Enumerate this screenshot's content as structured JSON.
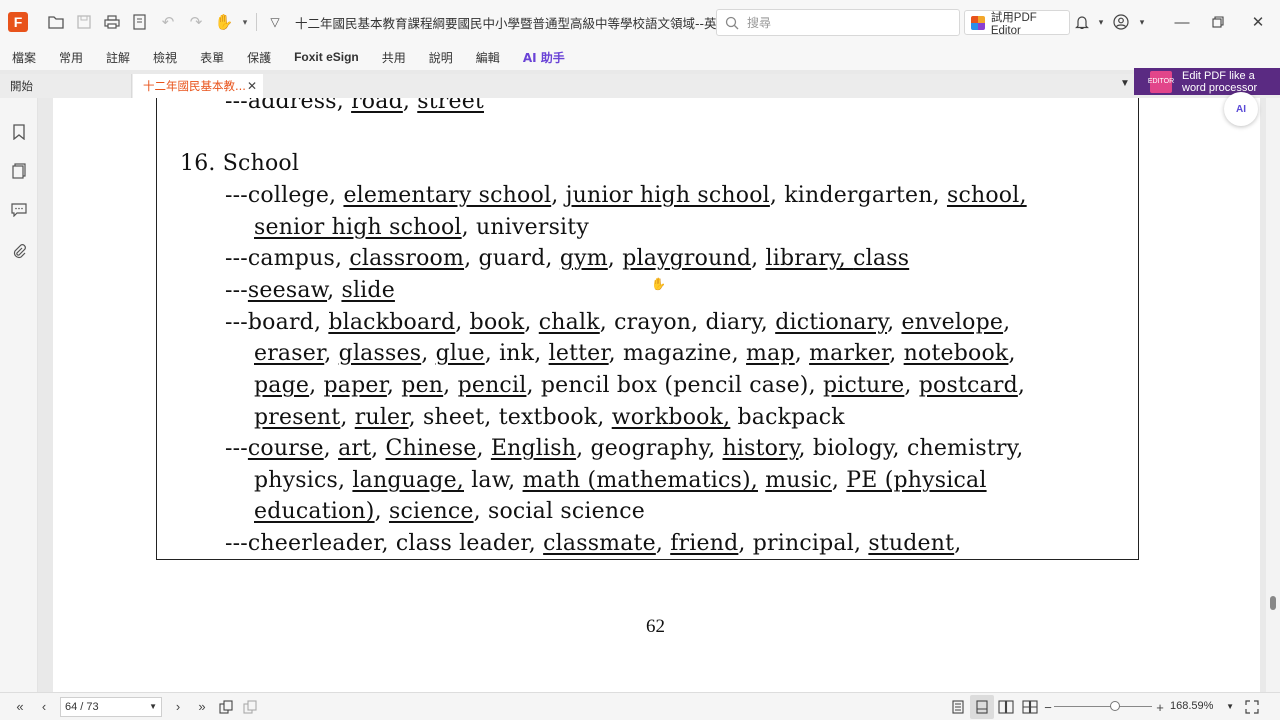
{
  "window": {
    "title": "十二年國民基本教育課程綱要國民中小學暨普通型高級中等學校語文領域--英語文.pdf",
    "search_placeholder": "搜尋",
    "try_editor_label": "試用PDF Editor"
  },
  "menu": [
    "檔案",
    "常用",
    "註解",
    "檢視",
    "表單",
    "保護",
    "Foxit eSign",
    "共用",
    "說明",
    "編輯",
    "AI 助手"
  ],
  "tabs": {
    "home": "開始",
    "document": "十二年國民基本教..."
  },
  "ad": {
    "line1": "Edit PDF like a",
    "line2": "word processor",
    "badge": "EDITOR"
  },
  "ai_float_label": "AI",
  "document": {
    "l0": {
      "a": "---address, ",
      "b": "road",
      "c": ", ",
      "d": "street"
    },
    "heading": "16. School",
    "l1": {
      "a": "---college, ",
      "b": "elementary school",
      "c": ", ",
      "d": "junior high school",
      "e": ", kindergarten, ",
      "f": "school,"
    },
    "l2": {
      "a": "senior high school",
      "b": ", university"
    },
    "l3": {
      "a": "---campus, ",
      "b": "classroom",
      "c": ", guard, ",
      "d": "gym",
      "e": ", ",
      "f": "playground",
      "g": ", ",
      "h": "library, ",
      "i": "class"
    },
    "l4": {
      "a": "---",
      "b": "seesaw",
      "c": ", ",
      "d": "slide"
    },
    "l5": {
      "a": "---board, ",
      "b": "blackboard",
      "c": ", ",
      "d": "book",
      "e": ", ",
      "f": "chalk",
      "g": ", crayon, diary, ",
      "h": "dictionary",
      "i": ", ",
      "j": "envelope",
      "k": ","
    },
    "l6": {
      "a": "eraser",
      "b": ", ",
      "c": "glasses",
      "d": ", ",
      "e": "glue",
      "f": ", ink, ",
      "g": "letter",
      "h": ", magazine, ",
      "i": "map",
      "j": ", ",
      "k": "marker",
      "l": ", ",
      "m": "notebook",
      "n": ","
    },
    "l7": {
      "a": "page",
      "b": ", ",
      "c": "paper",
      "d": ", ",
      "e": "pen",
      "f": ", ",
      "g": "pencil",
      "h": ", pencil box (pencil case), ",
      "i": "picture",
      "j": ", ",
      "k": "postcard",
      "l": ","
    },
    "l8": {
      "a": "present",
      "b": ", ",
      "c": "ruler",
      "d": ", sheet, textbook, ",
      "e": "workbook,",
      "f": " backpack"
    },
    "l9": {
      "a": "---",
      "b": "course",
      "c": ", ",
      "d": "art",
      "e": ", ",
      "f": "Chinese",
      "g": ", ",
      "h": "English",
      "i": ", geography, ",
      "j": "history",
      "k": ", biology, chemistry,"
    },
    "l10": {
      "a": "physics, ",
      "b": "language,",
      "c": " law, ",
      "d": "math (mathematics),",
      "e": " ",
      "f": "music",
      "g": ", ",
      "h": "PE (physical"
    },
    "l11": {
      "a": "education)",
      "b": ", ",
      "c": "science",
      "d": ", social science"
    },
    "l12": {
      "a": "---cheerleader, class leader, ",
      "b": "classmate",
      "c": ", ",
      "d": "friend",
      "e": ", principal, ",
      "f": "student",
      "g": ","
    },
    "page_number": "62"
  },
  "status": {
    "page_field": "64 / 73",
    "zoom": "168.59%"
  }
}
